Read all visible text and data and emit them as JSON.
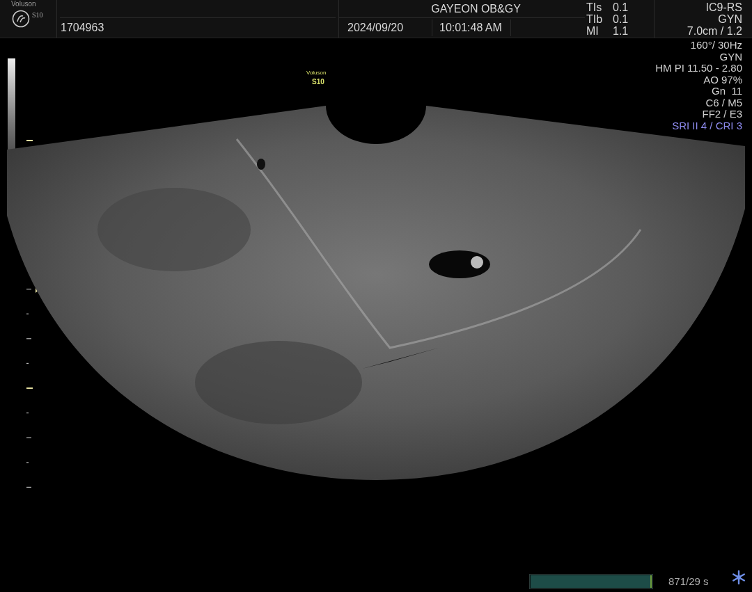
{
  "header": {
    "brand": "Voluson",
    "model": "S10",
    "patient_id": "1704963",
    "institution": "GAYEON OB&GY",
    "date": "2024/09/20",
    "time": "10:01:48 AM",
    "indices": [
      {
        "label": "TIs",
        "value": "0.1"
      },
      {
        "label": "TIb",
        "value": "0.1"
      },
      {
        "label": "MI",
        "value": "1.1"
      }
    ],
    "probe": [
      "IC9-RS",
      "GYN",
      "7.0cm / 1.2"
    ]
  },
  "parameters": [
    {
      "text": "160°/ 30Hz",
      "highlighted": false
    },
    {
      "text": "GYN",
      "highlighted": false
    },
    {
      "text": "HM PI 11.50 - 2.80",
      "highlighted": false
    },
    {
      "text": "AO 97%",
      "highlighted": false
    },
    {
      "text": "Gn  11",
      "highlighted": false
    },
    {
      "text": "C6 / M5",
      "highlighted": false
    },
    {
      "text": "FF2 / E3",
      "highlighted": false
    },
    {
      "text": "SRI II 4 / CRI 3",
      "highlighted": true
    }
  ],
  "image_label": {
    "brand": "Voluson",
    "model": "S10"
  },
  "cine": {
    "level": 1.0,
    "reading": "871/29 s"
  }
}
